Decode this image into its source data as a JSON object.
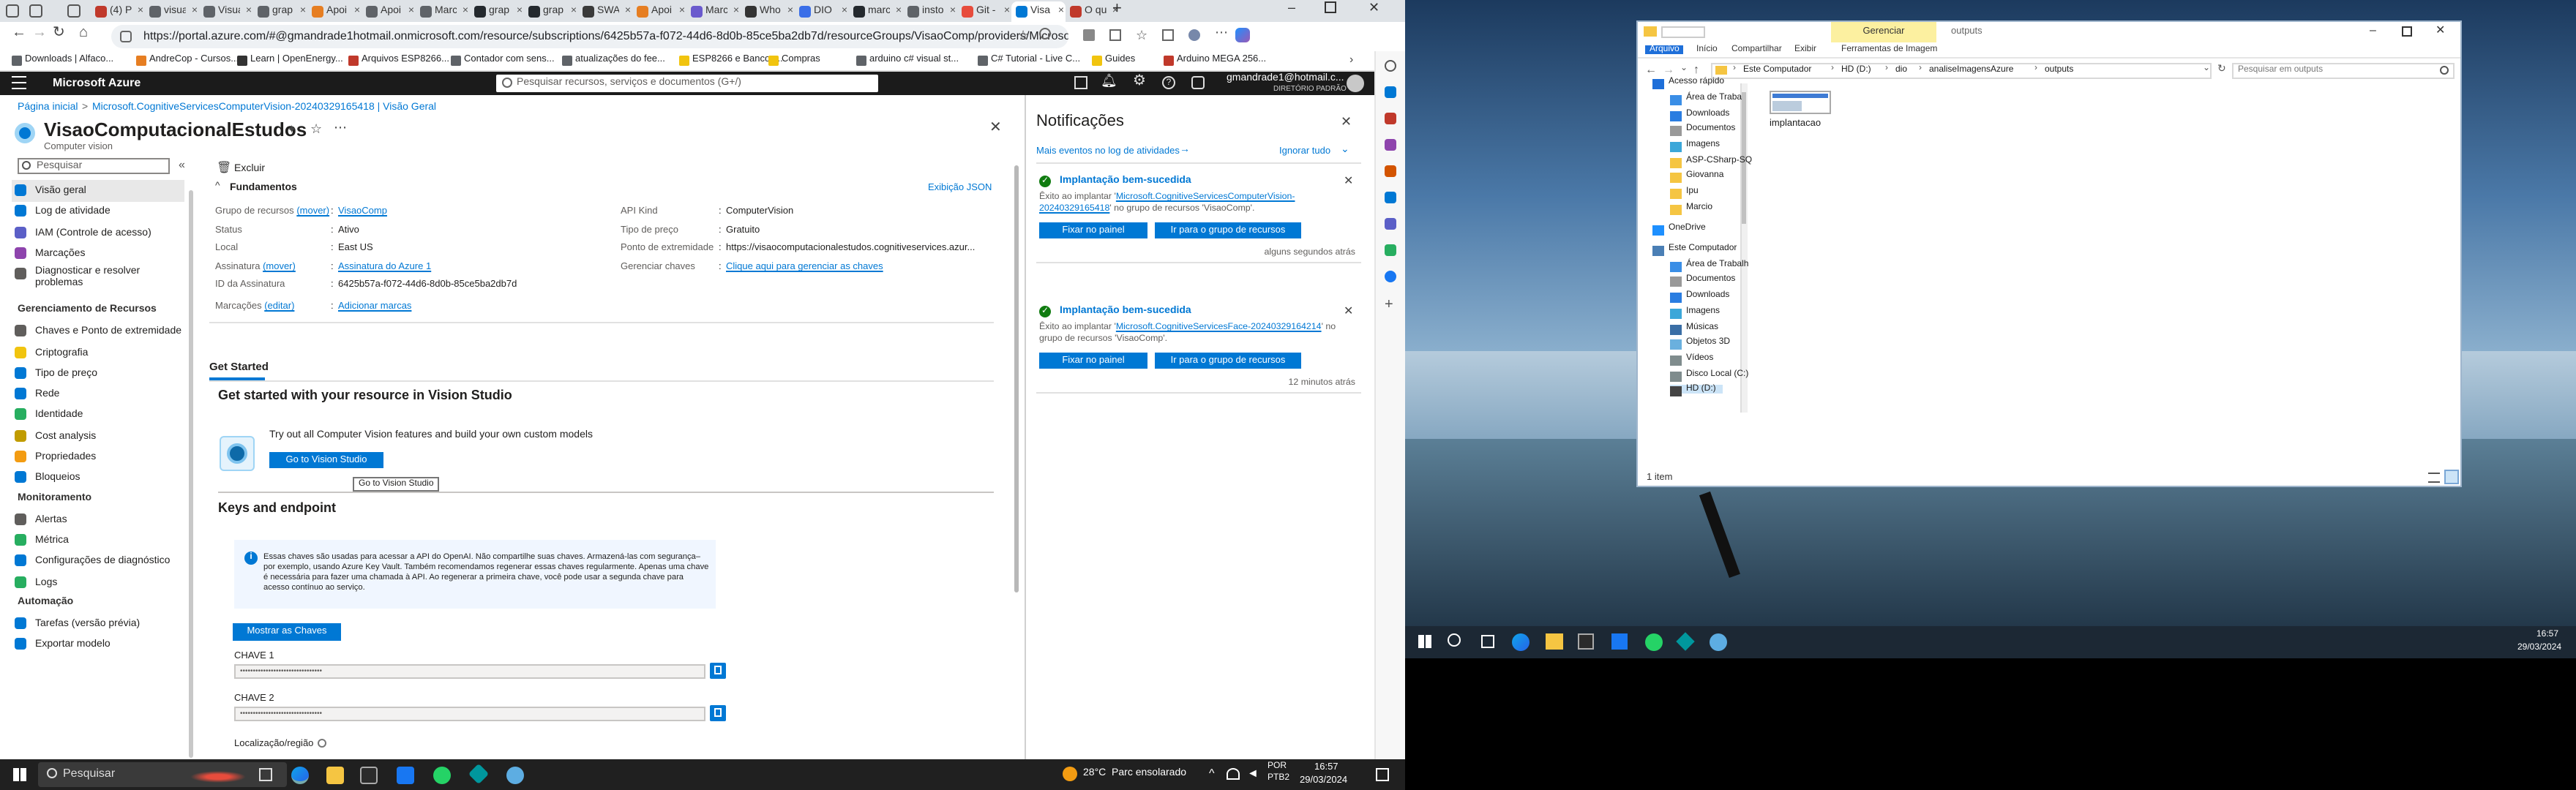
{
  "browser": {
    "tabs": [
      {
        "label": "(4) Pe",
        "color": "#c0392b"
      },
      {
        "label": "visua",
        "color": "#5f6368"
      },
      {
        "label": "Visua",
        "color": "#5f6368"
      },
      {
        "label": "grap",
        "color": "#5f6368"
      },
      {
        "label": "Apoi",
        "color": "#e67e22"
      },
      {
        "label": "Apoi",
        "color": "#5f6368"
      },
      {
        "label": "Marc",
        "color": "#5f6368"
      },
      {
        "label": "grap",
        "color": "#24292e"
      },
      {
        "label": "grap",
        "color": "#24292e"
      },
      {
        "label": "SWA",
        "color": "#3a3a3a"
      },
      {
        "label": "Apoi",
        "color": "#e67e22"
      },
      {
        "label": "Marc",
        "color": "#6a5acd"
      },
      {
        "label": "Who",
        "color": "#333"
      },
      {
        "label": "DIO",
        "color": "#3a6ee8"
      },
      {
        "label": "marc",
        "color": "#24292e"
      },
      {
        "label": "insto",
        "color": "#5f6368"
      },
      {
        "label": "Git -",
        "color": "#e74c3c"
      },
      {
        "label": "Visa",
        "color": "#0078d4"
      },
      {
        "label": "O qu",
        "color": "#c0392b"
      }
    ],
    "url": "https://portal.azure.com/#@gmandrade1hotmail.onmicrosoft.com/resource/subscriptions/6425b57a-f072-44d6-8d0b-85ce5ba2db7d/resourceGroups/VisaoComp/providers/Microsoft.CognitiveS...",
    "bookmarks": [
      {
        "label": "Downloads | Alfaco...",
        "color": "#5f6368"
      },
      {
        "label": "AndreCop - Cursos...",
        "color": "#e67e22"
      },
      {
        "label": "Learn | OpenEnergy...",
        "color": "#333"
      },
      {
        "label": "Arquivos ESP8266...",
        "color": "#c0392b"
      },
      {
        "label": "Contador com sens...",
        "color": "#5f6368"
      },
      {
        "label": "atualizações do fee...",
        "color": "#5f6368"
      },
      {
        "label": "ESP8266 e Bancos...",
        "color": "#f1c40f"
      },
      {
        "label": "Compras",
        "color": "#f1c40f"
      },
      {
        "label": "arduino c# visual st...",
        "color": "#5f6368"
      },
      {
        "label": "C# Tutorial - Live C...",
        "color": "#5f6368"
      },
      {
        "label": "Guides",
        "color": "#f1c40f"
      },
      {
        "label": "Arduino MEGA 256...",
        "color": "#c0392b"
      }
    ]
  },
  "azure": {
    "brand": "Microsoft Azure",
    "search_placeholder": "Pesquisar recursos, serviços e documentos (G+/)",
    "user_email": "gmandrade1@hotmail.c...",
    "user_dir": "DIRETÓRIO PADRÃO",
    "breadcrumb": [
      "Página inicial",
      "Microsoft.CognitiveServicesComputerVision-20240329165418 | Visão Geral"
    ],
    "resource_title": "VisaoComputacionalEstudos",
    "resource_subtitle": "Computer vision",
    "search_label": "Pesquisar",
    "delete_label": "Excluir",
    "nav": {
      "items_top": [
        "Visão geral",
        "Log de atividade",
        "IAM (Controle de acesso)",
        "Marcações",
        "Diagnosticar e resolver problemas"
      ],
      "section1": "Gerenciamento de Recursos",
      "items_res": [
        "Chaves e Ponto de extremidade",
        "Criptografia",
        "Tipo de preço",
        "Rede",
        "Identidade",
        "Cost analysis",
        "Propriedades",
        "Bloqueios"
      ],
      "section2": "Monitoramento",
      "items_mon": [
        "Alertas",
        "Métrica",
        "Configurações de diagnóstico",
        "Logs"
      ],
      "section3": "Automação",
      "items_auto": [
        "Tarefas (versão prévia)",
        "Exportar modelo"
      ]
    },
    "essentials": {
      "header": "Fundamentos",
      "json_view": "Exibição JSON",
      "left": [
        {
          "label": "Grupo de recursos",
          "extra": "(mover)",
          "value": "VisaoComp"
        },
        {
          "label": "Status",
          "value": "Ativo"
        },
        {
          "label": "Local",
          "value": "East US"
        },
        {
          "label": "Assinatura",
          "extra": "(mover)",
          "value": "Assinatura do Azure 1"
        },
        {
          "label": "ID da Assinatura",
          "value": "6425b57a-f072-44d6-8d0b-85ce5ba2db7d"
        },
        {
          "label": "Marcações",
          "extra": "(editar)",
          "value": "Adicionar marcas"
        }
      ],
      "right": [
        {
          "label": "API Kind",
          "value": "ComputerVision"
        },
        {
          "label": "Tipo de preço",
          "value": "Gratuito"
        },
        {
          "label": "Ponto de extremidade",
          "value": "https://visaocomputacionalestudos.cognitiveservices.azur..."
        },
        {
          "label": "Gerenciar chaves",
          "value": "Clique aqui para gerenciar as chaves"
        }
      ]
    },
    "getstarted_tab": "Get Started",
    "getstarted_heading": "Get started with your resource in Vision Studio",
    "getstarted_text": "Try out all Computer Vision features and build your own custom models",
    "go_button": "Go to Vision Studio",
    "tooltip": "Go to Vision Studio",
    "keys_heading": "Keys and endpoint",
    "keys_info": "Essas chaves são usadas para acessar a API do OpenAI. Não compartilhe suas chaves. Armazená-las com segurança– por exemplo, usando Azure Key Vault. Também recomendamos regenerar essas chaves regularmente. Apenas uma chave é necessária para fazer uma chamada à API. Ao regenerar a primeira chave, você pode usar a segunda chave para acesso contínuo ao serviço.",
    "show_keys": "Mostrar as Chaves",
    "key1_label": "CHAVE 1",
    "key2_label": "CHAVE 2",
    "key_mask": "••••••••••••••••••••••••••••••••",
    "location_label": "Localização/região"
  },
  "notifications": {
    "title": "Notificações",
    "more_events": "Mais eventos no log de atividades",
    "ignore_all": "Ignorar tudo",
    "cards": [
      {
        "title": "Implantação bem-sucedida",
        "body_pre": "Êxito ao implantar '",
        "body_link": "Microsoft.CognitiveServicesComputerVision-20240329165418",
        "body_post": "' no grupo de recursos 'VisaoComp'.",
        "btn1": "Fixar no painel",
        "btn2": "Ir para o grupo de recursos",
        "time": "alguns segundos atrás"
      },
      {
        "title": "Implantação bem-sucedida",
        "body_pre": "Êxito ao implantar '",
        "body_link": "Microsoft.CognitiveServicesFace-20240329164214",
        "body_post": "' no grupo de recursos 'VisaoComp'.",
        "btn1": "Fixar no painel",
        "btn2": "Ir para o grupo de recursos",
        "time": "12 minutos atrás"
      }
    ]
  },
  "taskbar_left": {
    "search": "Pesquisar",
    "weather": "28°C  Parc ensolarado",
    "lang": "POR",
    "lang2": "PTB2",
    "time": "16:57",
    "date": "29/03/2024"
  },
  "explorer": {
    "ribbon_context": "Gerenciar",
    "window_title": "outputs",
    "ribbon_tabs": [
      "Arquivo",
      "Início",
      "Compartilhar",
      "Exibir",
      "Ferramentas de Imagem"
    ],
    "path": [
      "Este Computador",
      "HD (D:)",
      "dio",
      "analiseImagensAzure",
      "outputs"
    ],
    "search_placeholder": "Pesquisar em outputs",
    "nav": [
      "Acesso rápido",
      "Área de Traba",
      "Downloads",
      "Documentos",
      "Imagens",
      "ASP-CSharp-SQ",
      "Giovanna",
      "Ipu",
      "Marcio",
      "OneDrive",
      "Este Computador",
      "Área de Trabalh",
      "Documentos",
      "Downloads",
      "Imagens",
      "Músicas",
      "Objetos 3D",
      "Vídeos",
      "Disco Local (C:)",
      "HD (D:)"
    ],
    "file_name": "implantacao",
    "status": "1 item"
  },
  "taskbar_right": {
    "time": "16:57",
    "date": "29/03/2024"
  }
}
